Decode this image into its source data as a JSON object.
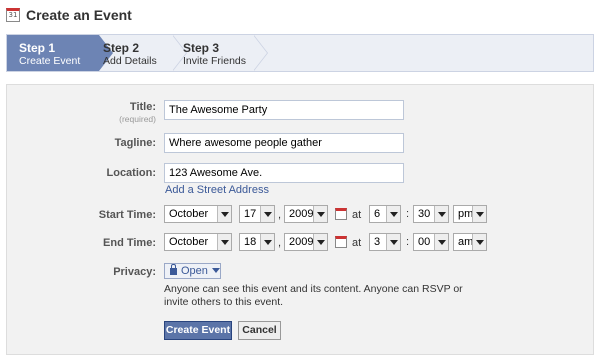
{
  "header": {
    "calendar_icon_text": "31",
    "title": "Create an Event"
  },
  "steps": [
    {
      "number": "Step 1",
      "label": "Create Event"
    },
    {
      "number": "Step 2",
      "label": "Add Details"
    },
    {
      "number": "Step 3",
      "label": "Invite Friends"
    }
  ],
  "form": {
    "title": {
      "label": "Title:",
      "required_note": "(required)",
      "value": "The Awesome Party"
    },
    "tagline": {
      "label": "Tagline:",
      "value": "Where awesome people gather"
    },
    "location": {
      "label": "Location:",
      "value": "123 Awesome Ave.",
      "street_link": "Add a Street Address"
    },
    "start": {
      "label": "Start Time:",
      "month": "October",
      "day": "17",
      "year": "2009",
      "at": "at",
      "hour": "6",
      "minute": "30",
      "ampm": "pm"
    },
    "end": {
      "label": "End Time:",
      "month": "October",
      "day": "18",
      "year": "2009",
      "at": "at",
      "hour": "3",
      "minute": "00",
      "ampm": "am"
    },
    "privacy": {
      "label": "Privacy:",
      "value": "Open",
      "description": "Anyone can see this event and its content. Anyone can RSVP or invite others to this event."
    },
    "separators": {
      "comma": ",",
      "colon": ":"
    }
  },
  "buttons": {
    "create": "Create Event",
    "cancel": "Cancel"
  },
  "colors": {
    "accent": "#6d84b4",
    "link": "#3b5998",
    "panel_bg": "#f2f2f2"
  }
}
